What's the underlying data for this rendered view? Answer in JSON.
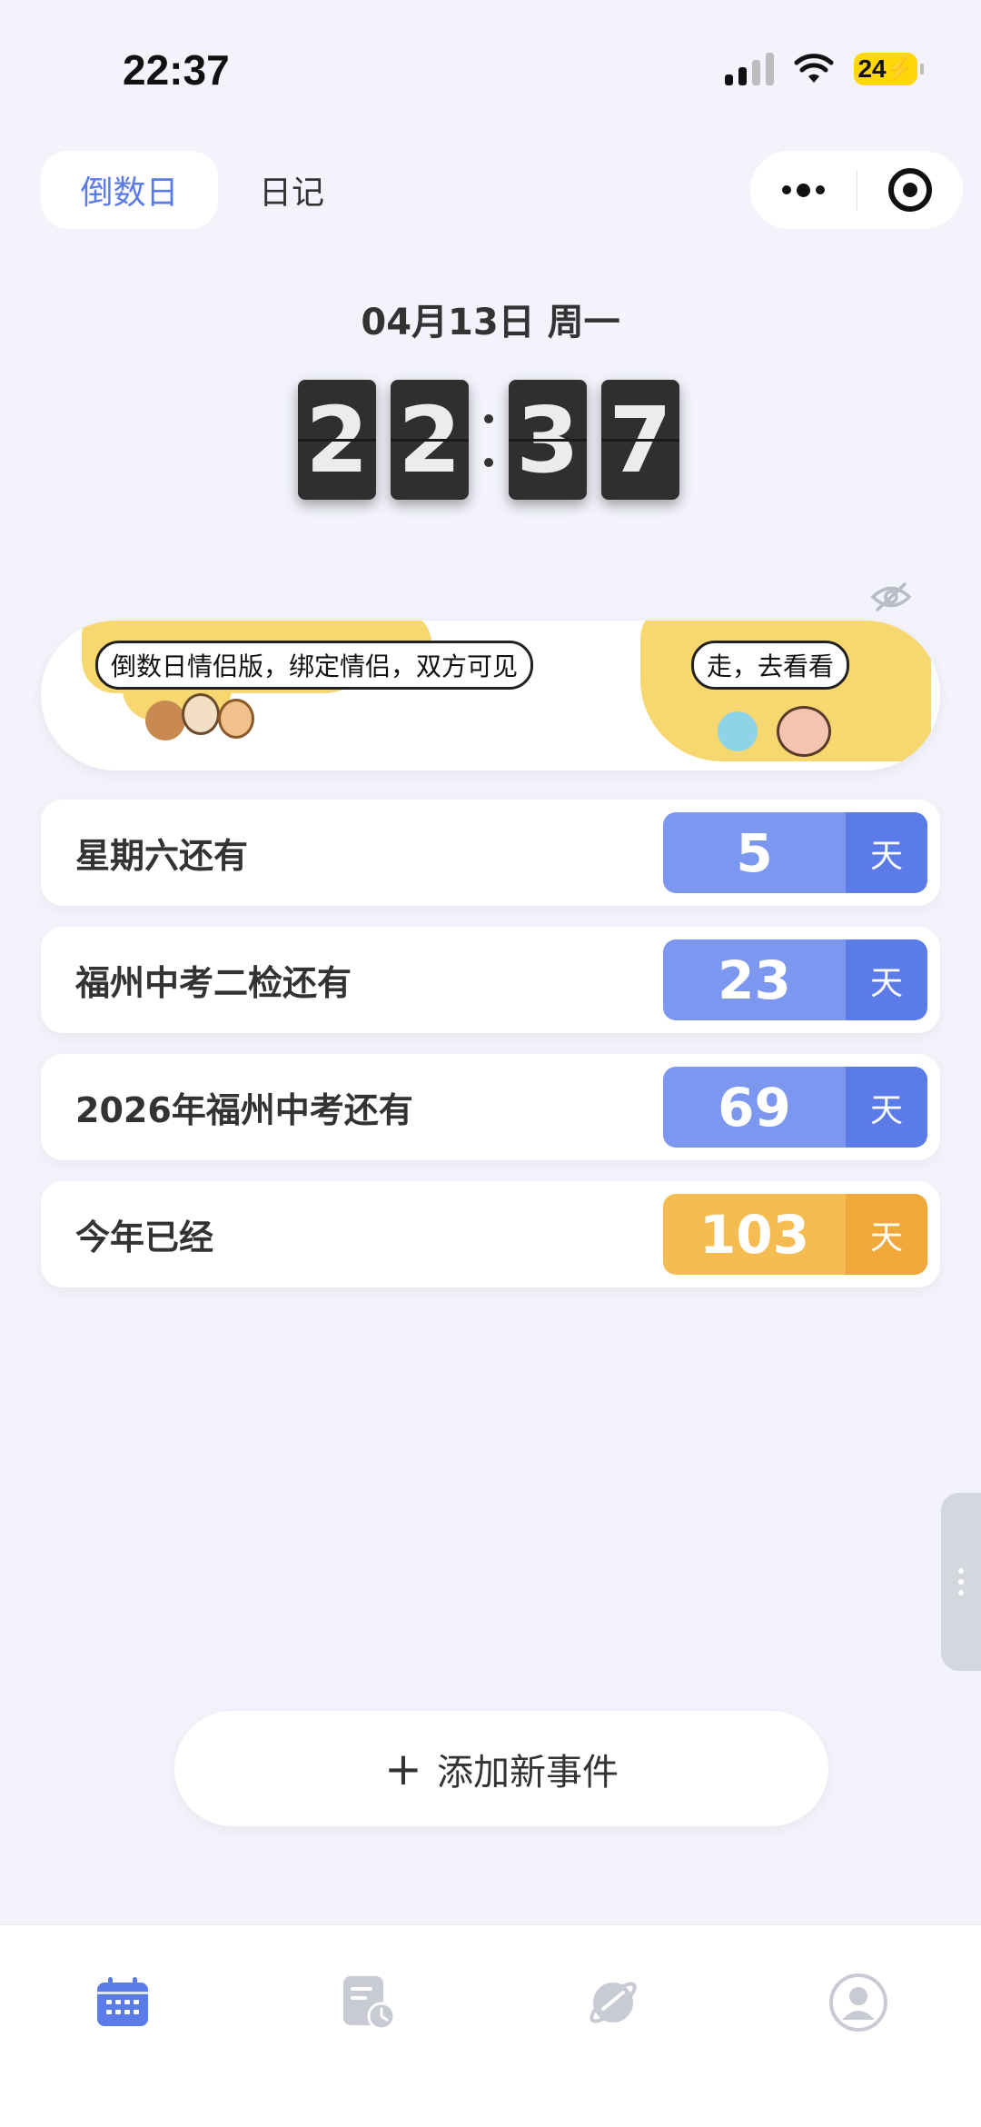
{
  "status_bar": {
    "time": "22:37",
    "battery": "24",
    "icons": [
      "signal-icon",
      "wifi-icon",
      "battery-charging-icon"
    ]
  },
  "header": {
    "tabs": [
      {
        "label": "倒数日",
        "active": true
      },
      {
        "label": "日记",
        "active": false
      }
    ],
    "capsule_icons": [
      "more-icon",
      "close-target-icon"
    ]
  },
  "clock": {
    "date": "04月13日 周一",
    "digits": [
      "2",
      "2",
      "3",
      "7"
    ]
  },
  "banner": {
    "left_text": "倒数日情侣版，绑定情侣，双方可见",
    "right_text": "走，去看看",
    "hide_icon": "eye-off-icon"
  },
  "events": [
    {
      "name": "星期六还有",
      "count": "5",
      "unit": "天",
      "color": "#7b97f0"
    },
    {
      "name": "福州中考二检还有",
      "count": "23",
      "unit": "天",
      "color": "#7b97f0"
    },
    {
      "name": "2026年福州中考还有",
      "count": "69",
      "unit": "天",
      "color": "#7b97f0"
    },
    {
      "name": "今年已经",
      "count": "103",
      "unit": "天",
      "color": "#f5bc52"
    }
  ],
  "add_button": {
    "plus": "+",
    "label": "添加新事件"
  },
  "bottom_nav": [
    {
      "icon": "calendar-icon",
      "active": true
    },
    {
      "icon": "diary-clock-icon",
      "active": false
    },
    {
      "icon": "planet-icon",
      "active": false
    },
    {
      "icon": "profile-icon",
      "active": false
    }
  ],
  "colors": {
    "accent": "#5b7be8",
    "background": "#f2f3fb",
    "orange": "#f5bc52"
  }
}
